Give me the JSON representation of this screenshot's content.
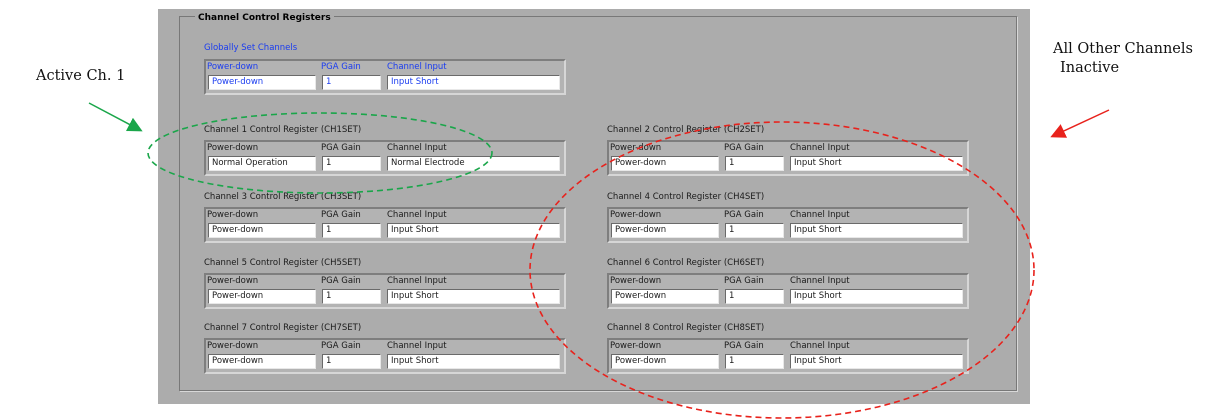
{
  "group_title": "Channel Control Registers",
  "global": {
    "title": "Globally Set Channels",
    "labels": {
      "power_down": "Power-down",
      "pga_gain": "PGA Gain",
      "channel_input": "Channel Input"
    },
    "values": {
      "power_down": "Power-down",
      "pga_gain": "1",
      "channel_input": "Input Short"
    }
  },
  "channels": [
    {
      "title": "Channel 1 Control Register (CH1SET)",
      "labels": {
        "power_down": "Power-down",
        "pga_gain": "PGA Gain",
        "channel_input": "Channel Input"
      },
      "values": {
        "power_down": "Normal Operation",
        "pga_gain": "1",
        "channel_input": "Normal Electrode"
      }
    },
    {
      "title": "Channel 2 Control Register (CH2SET)",
      "labels": {
        "power_down": "Power-down",
        "pga_gain": "PGA Gain",
        "channel_input": "Channel Input"
      },
      "values": {
        "power_down": "Power-down",
        "pga_gain": "1",
        "channel_input": "Input Short"
      }
    },
    {
      "title": "Channel 3 Control Register (CH3SET)",
      "labels": {
        "power_down": "Power-down",
        "pga_gain": "PGA Gain",
        "channel_input": "Channel Input"
      },
      "values": {
        "power_down": "Power-down",
        "pga_gain": "1",
        "channel_input": "Input Short"
      }
    },
    {
      "title": "Channel 4 Control Register (CH4SET)",
      "labels": {
        "power_down": "Power-down",
        "pga_gain": "PGA Gain",
        "channel_input": "Channel Input"
      },
      "values": {
        "power_down": "Power-down",
        "pga_gain": "1",
        "channel_input": "Input Short"
      }
    },
    {
      "title": "Channel 5 Control Register (CH5SET)",
      "labels": {
        "power_down": "Power-down",
        "pga_gain": "PGA Gain",
        "channel_input": "Channel Input"
      },
      "values": {
        "power_down": "Power-down",
        "pga_gain": "1",
        "channel_input": "Input Short"
      }
    },
    {
      "title": "Channel 6 Control Register (CH6SET)",
      "labels": {
        "power_down": "Power-down",
        "pga_gain": "PGA Gain",
        "channel_input": "Channel Input"
      },
      "values": {
        "power_down": "Power-down",
        "pga_gain": "1",
        "channel_input": "Input Short"
      }
    },
    {
      "title": "Channel 7 Control Register (CH7SET)",
      "labels": {
        "power_down": "Power-down",
        "pga_gain": "PGA Gain",
        "channel_input": "Channel Input"
      },
      "values": {
        "power_down": "Power-down",
        "pga_gain": "1",
        "channel_input": "Input Short"
      }
    },
    {
      "title": "Channel 8 Control Register (CH8SET)",
      "labels": {
        "power_down": "Power-down",
        "pga_gain": "PGA Gain",
        "channel_input": "Channel Input"
      },
      "values": {
        "power_down": "Power-down",
        "pga_gain": "1",
        "channel_input": "Input Short"
      }
    }
  ],
  "annotations": {
    "active": "Active Ch. 1",
    "inactive_line1": "All Other Channels",
    "inactive_line2": "Inactive",
    "active_color": "#1aa64a",
    "inactive_color": "#e8221c"
  }
}
